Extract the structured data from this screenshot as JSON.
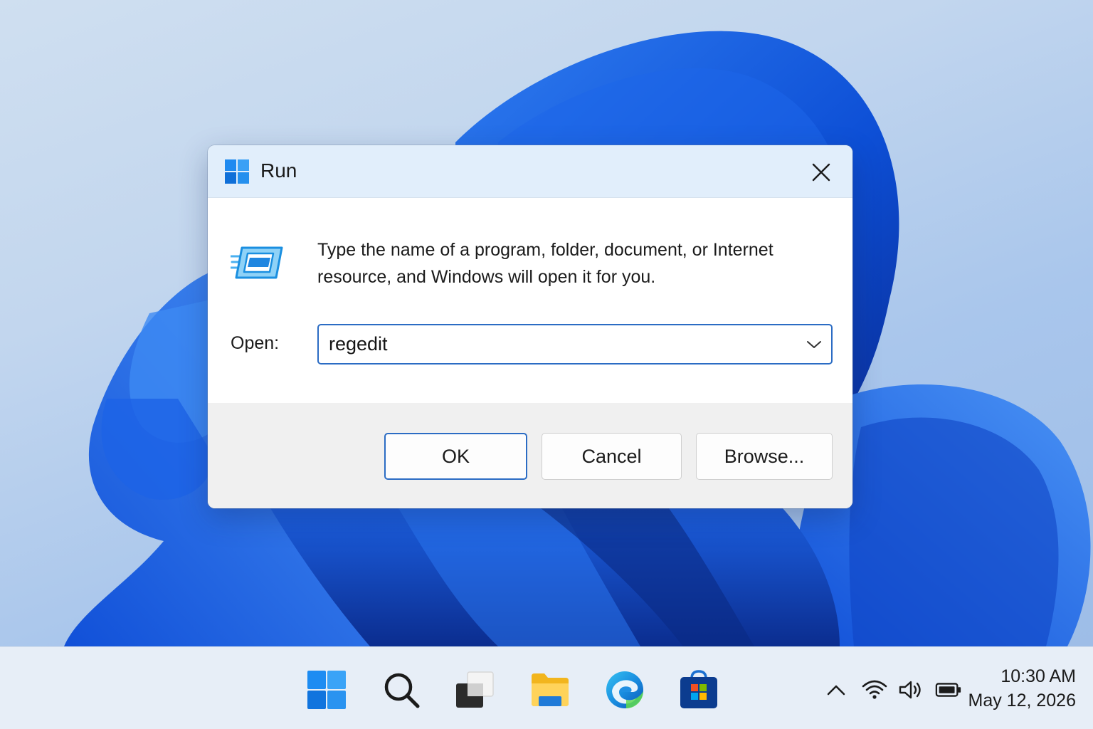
{
  "desktop": {
    "wallpaper": "windows-11-bloom"
  },
  "dialog": {
    "title": "Run",
    "title_icon": "windows-logo-icon",
    "close_icon": "close-icon",
    "run_icon": "run-app-icon",
    "description": "Type the name of a program, folder, document, or Internet resource, and Windows will open it for you.",
    "open_label": "Open:",
    "open_value": "regedit",
    "dropdown_icon": "chevron-down-icon",
    "buttons": {
      "ok": "OK",
      "cancel": "Cancel",
      "browse": "Browse..."
    }
  },
  "taskbar": {
    "apps": [
      "start-icon",
      "search-icon",
      "task-view-icon",
      "file-explorer-icon",
      "edge-icon",
      "microsoft-store-icon"
    ],
    "tray": [
      "chevron-up-icon",
      "wifi-icon",
      "volume-icon",
      "battery-icon"
    ],
    "time": "10:30 AM",
    "date": "May 12, 2026"
  },
  "colors": {
    "accent": "#2b6cc4",
    "titlebar": "#e1eefb",
    "footer": "#f0f0f0",
    "taskbar": "#e7eef7"
  }
}
